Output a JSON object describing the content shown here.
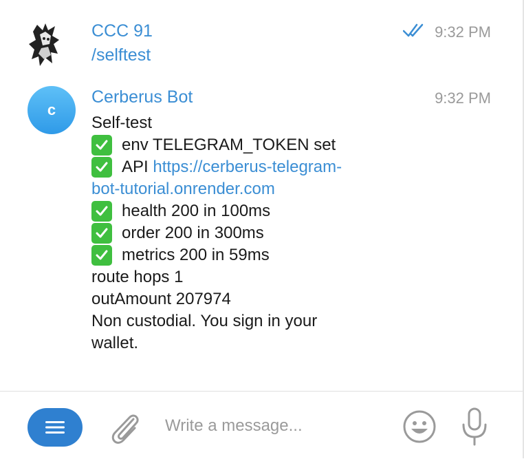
{
  "messages": [
    {
      "sender": "CCC 91",
      "time": "9:32 PM",
      "text": "/selftest",
      "status": "read"
    },
    {
      "sender": "Cerberus Bot",
      "avatar_letter": "c",
      "time": "9:32 PM",
      "lines": {
        "title": "Self-test",
        "env": "env TELEGRAM_TOKEN set",
        "api_prefix": "API ",
        "api_link_part1": "https://cerberus-telegram-",
        "api_link_part2": "bot-tutorial.onrender.com",
        "health": "health 200 in 100ms",
        "order": "order 200 in 300ms",
        "metrics": "metrics 200 in 59ms",
        "route": "route hops 1",
        "out": "outAmount 207974",
        "note1": "Non custodial. You sign in your",
        "note2": "wallet."
      }
    }
  ],
  "composer": {
    "placeholder": "Write a message..."
  },
  "icons": {
    "menu": "menu-icon",
    "attach": "paperclip-icon",
    "emoji": "emoji-icon",
    "mic": "microphone-icon",
    "check": "check-mark-icon",
    "read": "double-check-icon"
  },
  "colors": {
    "accent": "#3b8ed4",
    "button": "#2f80d0",
    "check": "#3fbf3f",
    "timestamp": "#9a9a9a"
  }
}
